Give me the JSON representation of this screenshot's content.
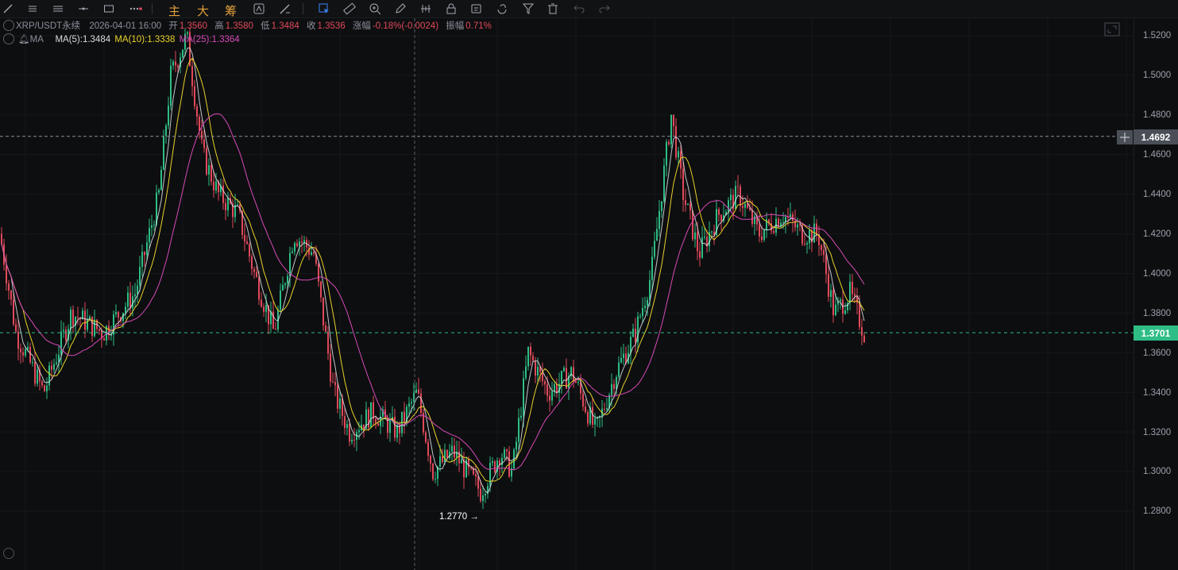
{
  "toolbar": {
    "left_icons": [
      "trend-line-icon",
      "parallel-lines-icon",
      "horizontal-lines-icon",
      "horizontal-segment-icon",
      "rectangle-icon",
      "more-dots-icon"
    ],
    "cn_buttons": [
      "主",
      "大",
      "筹"
    ],
    "right_icons": [
      "cycle-icon",
      "brush-ruler-icon",
      "select-cursor-icon",
      "ruler-icon",
      "zoom-in-icon",
      "pencil-icon",
      "bars-icon",
      "lock-icon",
      "edit-box-icon",
      "magnet-icon",
      "filter-icon",
      "trash-icon",
      "undo-icon",
      "redo-icon"
    ]
  },
  "header": {
    "symbol": "XRP/USDT永续",
    "datetime": "2026-04-01 16:00",
    "open_label": "开",
    "open_value": "1.3560",
    "high_label": "高",
    "high_value": "1.3580",
    "low_label": "低",
    "low_value": "1.3484",
    "close_label": "收",
    "close_value": "1.3536",
    "change_label": "涨幅",
    "change_value": "-0.18%(-0.0024)",
    "amp_label": "振幅",
    "amp_value": "0.71%"
  },
  "ma_legend": {
    "indicator": "MA",
    "ma5": "MA(5):1.3484",
    "ma10": "MA(10):1.3338",
    "ma25": "MA(25):1.3364"
  },
  "price_axis": {
    "ticks": [
      "1.5200",
      "1.5000",
      "1.4800",
      "1.4600",
      "1.4400",
      "1.4200",
      "1.4000",
      "1.3800",
      "1.3600",
      "1.3400",
      "1.3200",
      "1.3000",
      "1.2800"
    ],
    "crosshair_price": "1.4692",
    "last_price": "1.3701"
  },
  "annotations": {
    "low_marker": "1.2770 →"
  },
  "colors": {
    "up": "#2ebd85",
    "down": "#e0495a",
    "ma5": "#e3e6ea",
    "ma10": "#e8d22a",
    "ma25": "#d84ab8",
    "last_price_tag": "#2ebd85",
    "background": "#0d0e10"
  }
}
